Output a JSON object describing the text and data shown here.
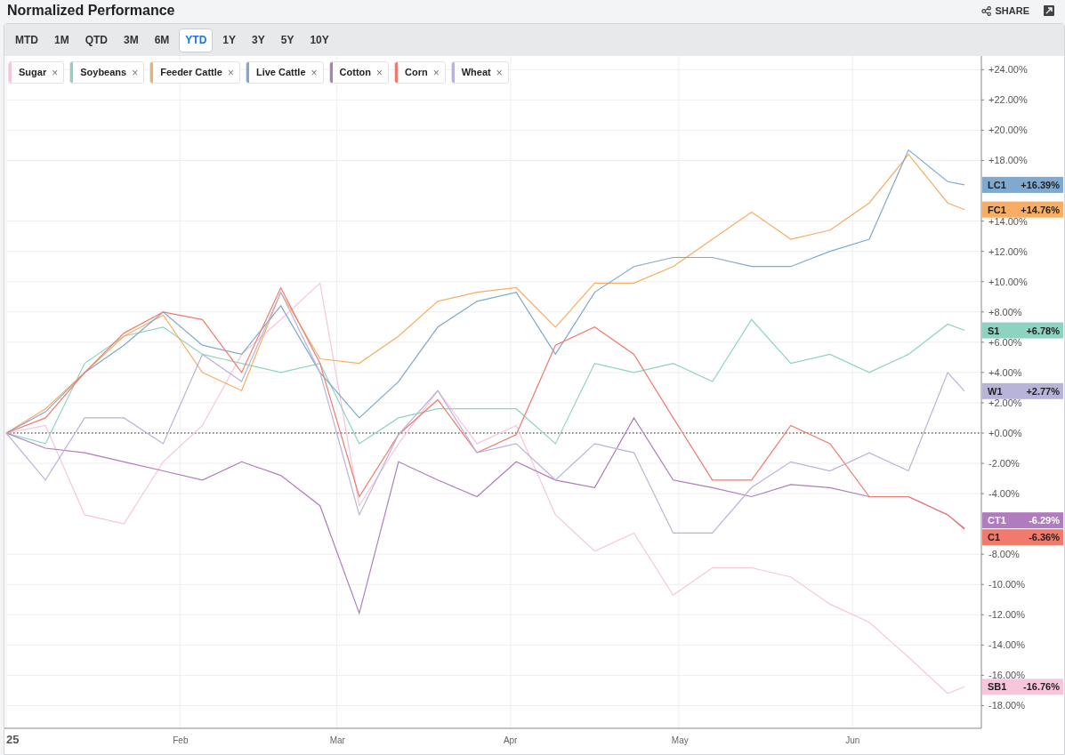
{
  "title": "Normalized Performance",
  "share": {
    "label": "SHARE"
  },
  "ranges": [
    {
      "label": "MTD",
      "selected": false
    },
    {
      "label": "1M",
      "selected": false
    },
    {
      "label": "QTD",
      "selected": false
    },
    {
      "label": "3M",
      "selected": false
    },
    {
      "label": "6M",
      "selected": false
    },
    {
      "label": "YTD",
      "selected": true
    },
    {
      "label": "1Y",
      "selected": false
    },
    {
      "label": "3Y",
      "selected": false
    },
    {
      "label": "5Y",
      "selected": false
    },
    {
      "label": "10Y",
      "selected": false
    }
  ],
  "legend_remove": "×",
  "price_tags": [
    {
      "symbol": "LC1",
      "change": "+16.39%",
      "color": "#7fa9cf",
      "light_text": false
    },
    {
      "symbol": "FC1",
      "change": "+14.76%",
      "color": "#f8ad62",
      "light_text": false
    },
    {
      "symbol": "S1",
      "change": "+6.78%",
      "color": "#8dd3c2",
      "light_text": false
    },
    {
      "symbol": "W1",
      "change": "+2.77%",
      "color": "#b8b4d9",
      "light_text": false
    },
    {
      "symbol": "CT1",
      "change": "-6.29%",
      "color": "#b07cbd",
      "light_text": true
    },
    {
      "symbol": "C1",
      "change": "-6.36%",
      "color": "#f27a6c",
      "light_text": false
    },
    {
      "symbol": "SB1",
      "change": "-16.76%",
      "color": "#f7c6dc",
      "light_text": false
    }
  ],
  "chart_data": {
    "type": "line",
    "x": [
      "2025-01-01",
      "2025-01-08",
      "2025-01-15",
      "2025-01-22",
      "2025-01-29",
      "2025-02-05",
      "2025-02-12",
      "2025-02-19",
      "2025-02-26",
      "2025-03-05",
      "2025-03-12",
      "2025-03-19",
      "2025-03-26",
      "2025-04-02",
      "2025-04-09",
      "2025-04-16",
      "2025-04-23",
      "2025-04-30",
      "2025-05-07",
      "2025-05-14",
      "2025-05-21",
      "2025-05-28",
      "2025-06-04",
      "2025-06-11",
      "2025-06-18",
      "2025-06-21"
    ],
    "xlim": [
      "2025-01-01",
      "2025-06-24"
    ],
    "grid": true,
    "ref_lines": [
      {
        "axis": "y",
        "value": 0
      }
    ],
    "ylim": [
      -19.5,
      24.9
    ],
    "xticks": [
      {
        "value": "2025-01-01",
        "label": "25"
      },
      {
        "value": "2025-02-01",
        "label": "Feb"
      },
      {
        "value": "2025-03-01",
        "label": "Mar"
      },
      {
        "value": "2025-04-01",
        "label": "Apr"
      },
      {
        "value": "2025-05-01",
        "label": "May"
      },
      {
        "value": "2025-06-01",
        "label": "Jun"
      }
    ],
    "yticks": [
      {
        "value": 24,
        "label": "+24.00%"
      },
      {
        "value": 22,
        "label": "+22.00%"
      },
      {
        "value": 20,
        "label": "+20.00%"
      },
      {
        "value": 18,
        "label": "+18.00%"
      },
      {
        "value": 14,
        "label": "+14.00%"
      },
      {
        "value": 12,
        "label": "+12.00%"
      },
      {
        "value": 10,
        "label": "+10.00%"
      },
      {
        "value": 8,
        "label": "+8.00%"
      },
      {
        "value": 6,
        "label": "+6.00%"
      },
      {
        "value": 4,
        "label": "+4.00%"
      },
      {
        "value": 2,
        "label": "+2.00%"
      },
      {
        "value": 0,
        "label": "+0.00%"
      },
      {
        "value": -2,
        "label": "-2.00%"
      },
      {
        "value": -4,
        "label": "-4.00%"
      },
      {
        "value": -8,
        "label": "-8.00%"
      },
      {
        "value": -10,
        "label": "-10.00%"
      },
      {
        "value": -12,
        "label": "-12.00%"
      },
      {
        "value": -14,
        "label": "-14.00%"
      },
      {
        "value": -16,
        "label": "-16.00%"
      },
      {
        "value": -18,
        "label": "-18.00%"
      }
    ],
    "series": [
      {
        "name": "Sugar",
        "color": "#f7c6dc",
        "values": [
          0,
          0.5,
          -5.4,
          -6,
          -1.9,
          0.5,
          5.2,
          7.5,
          9.9,
          -4.8,
          -0.7,
          2.8,
          -0.7,
          0.5,
          -5.4,
          -7.8,
          -6.6,
          -10.7,
          -8.9,
          -8.9,
          -9.5,
          -11.3,
          -12.5,
          -14.8,
          -17.2,
          -16.76
        ]
      },
      {
        "name": "Soybeans",
        "color": "#8dd3c2",
        "values": [
          0,
          -0.7,
          4.6,
          6.4,
          7,
          5.2,
          4.6,
          4,
          4.6,
          -0.7,
          1,
          1.6,
          1.6,
          1.6,
          -0.7,
          4.6,
          4,
          4.6,
          3.4,
          7.5,
          4.6,
          5.2,
          4,
          5.2,
          7.2,
          6.78
        ]
      },
      {
        "name": "Feeder Cattle",
        "color": "#f8ad62",
        "values": [
          0,
          1.6,
          4,
          6.4,
          7.8,
          4,
          2.8,
          9.3,
          4.9,
          4.6,
          6.4,
          8.7,
          9.3,
          9.6,
          7,
          9.9,
          9.9,
          11,
          12.8,
          14.6,
          12.8,
          13.4,
          15.2,
          18.4,
          15.2,
          14.76
        ]
      },
      {
        "name": "Live Cattle",
        "color": "#7fa9cf",
        "values": [
          0,
          1.4,
          4,
          5.8,
          8,
          5.8,
          5.2,
          8.4,
          4,
          1,
          3.4,
          7,
          8.7,
          9.3,
          5.2,
          9.3,
          11,
          11.6,
          11.6,
          11,
          11,
          12,
          12.8,
          18.7,
          16.6,
          16.39
        ]
      },
      {
        "name": "Cotton",
        "color": "#b07cbd",
        "values": [
          0,
          -1,
          -1.3,
          -1.9,
          -2.5,
          -3.1,
          -1.9,
          -2.8,
          -4.8,
          -11.9,
          -1.9,
          -3.1,
          -4.2,
          -1.9,
          -3.1,
          -3.6,
          1,
          -3.1,
          -3.6,
          -4.2,
          -3.4,
          -3.6,
          -4.2,
          -4.2,
          -5.4,
          -6.29
        ]
      },
      {
        "name": "Corn",
        "color": "#f27a6c",
        "values": [
          0,
          1,
          4,
          6.6,
          8,
          7.5,
          4,
          9.6,
          4.6,
          -4.2,
          -0.1,
          2.2,
          -1.3,
          -0.1,
          5.8,
          7,
          5.2,
          1,
          -3.1,
          -3.1,
          0.5,
          -0.7,
          -4.2,
          -4.2,
          -5.4,
          -6.36
        ]
      },
      {
        "name": "Wheat",
        "color": "#b8b4d9",
        "values": [
          0,
          -3.1,
          1,
          1,
          -0.7,
          5.2,
          3.4,
          9.3,
          4,
          -5.4,
          -0.1,
          2.8,
          -1.3,
          -0.7,
          -3.1,
          -0.7,
          -1.3,
          -6.6,
          -6.6,
          -3.6,
          -1.9,
          -2.5,
          -1.3,
          -2.5,
          4,
          2.77
        ]
      }
    ]
  }
}
